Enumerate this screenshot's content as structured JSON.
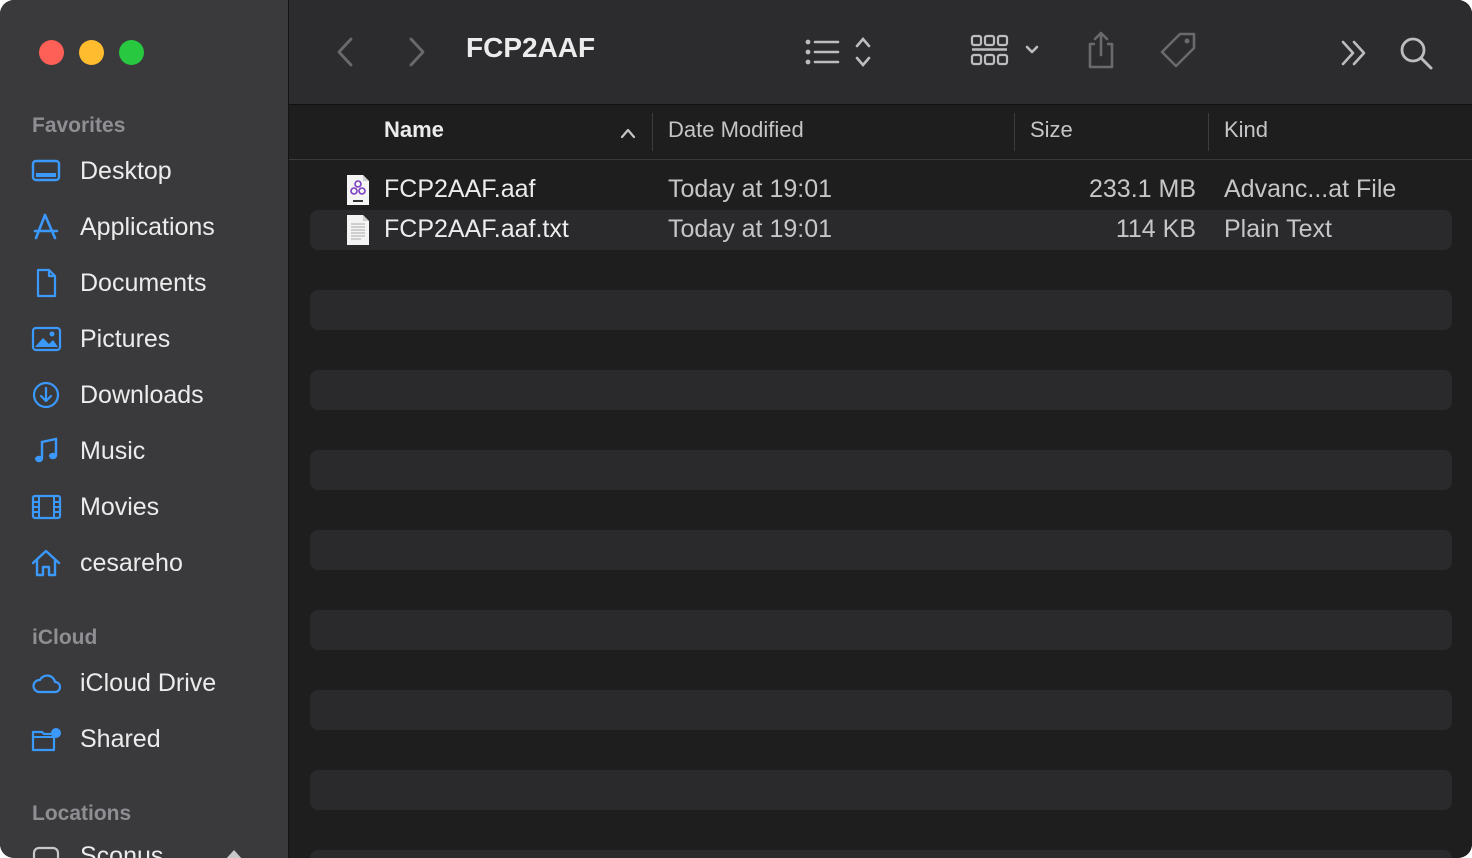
{
  "window": {
    "title": "FCP2AAF"
  },
  "sidebar": {
    "sections": [
      {
        "title": "Favorites",
        "items": [
          {
            "label": "Desktop",
            "icon": "desktop-icon"
          },
          {
            "label": "Applications",
            "icon": "applications-icon"
          },
          {
            "label": "Documents",
            "icon": "document-icon"
          },
          {
            "label": "Pictures",
            "icon": "pictures-icon"
          },
          {
            "label": "Downloads",
            "icon": "downloads-icon"
          },
          {
            "label": "Music",
            "icon": "music-icon"
          },
          {
            "label": "Movies",
            "icon": "movies-icon"
          },
          {
            "label": "cesareho",
            "icon": "home-icon"
          }
        ]
      },
      {
        "title": "iCloud",
        "items": [
          {
            "label": "iCloud Drive",
            "icon": "cloud-icon"
          },
          {
            "label": "Shared",
            "icon": "shared-folder-icon"
          }
        ]
      },
      {
        "title": "Locations",
        "items": [
          {
            "label": "Sconus",
            "icon": "disk-icon"
          }
        ]
      }
    ]
  },
  "toolbar": {
    "icons": [
      "back-icon",
      "forward-icon",
      "list-view-icon",
      "gallery-view-icon",
      "share-icon",
      "tag-icon",
      "more-icon",
      "search-icon"
    ]
  },
  "columns": {
    "name": "Name",
    "date": "Date Modified",
    "size": "Size",
    "kind": "Kind"
  },
  "files": [
    {
      "name": "FCP2AAF.aaf",
      "date": "Today at 19:01",
      "size": "233.1 MB",
      "kind": "Advanc...at File",
      "icon": "aaf-file-icon"
    },
    {
      "name": "FCP2AAF.aaf.txt",
      "date": "Today at 19:01",
      "size": "114 KB",
      "kind": "Plain Text",
      "icon": "text-file-icon"
    }
  ],
  "colors": {
    "accent": "#3b99fc",
    "sidebar_bg": "#3a3a3c",
    "content_bg": "#1e1e1e",
    "stripe": "#2a2a2c",
    "close": "#fe5f57",
    "minimize": "#febc2e",
    "zoom": "#28c840"
  }
}
